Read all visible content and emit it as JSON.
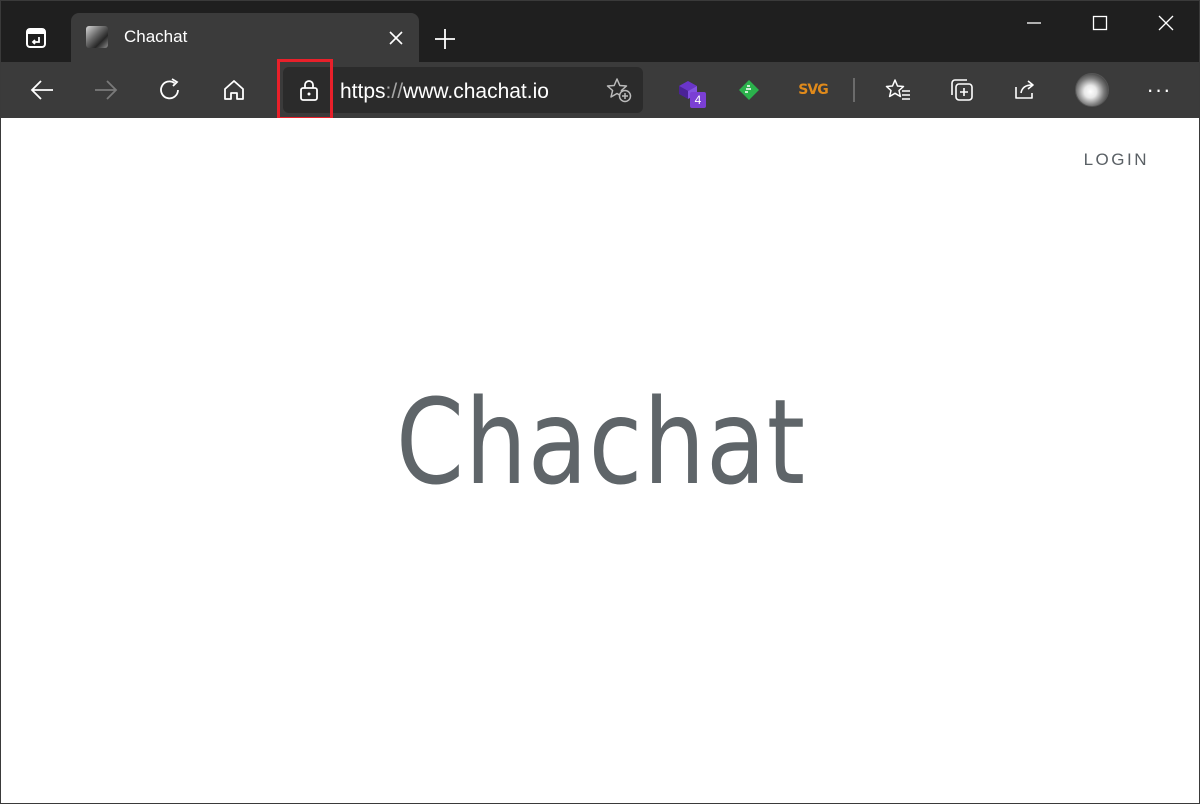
{
  "browser": {
    "tab": {
      "title": "Chachat"
    },
    "address_bar": {
      "scheme": "https",
      "separator": "://",
      "host": "www.chachat.io"
    },
    "extensions": [
      {
        "name": "extension-purple-icon",
        "badge": "4"
      },
      {
        "name": "feedly-icon"
      },
      {
        "name": "svg-extension-icon",
        "label": "SVG"
      }
    ],
    "icons": {
      "back": "back-arrow-icon",
      "forward": "forward-arrow-icon",
      "refresh": "refresh-icon",
      "home": "home-icon",
      "lock": "lock-icon",
      "add_favorite": "add-favorite-icon",
      "favorites": "favorites-icon",
      "collections": "collections-icon",
      "share": "share-icon",
      "more": "more-icon"
    },
    "colors": {
      "titlebar": "#1f1f1f",
      "toolbar": "#3b3b3b",
      "highlight": "#e8202a",
      "extension_badge": "#7b3fd4",
      "feedly_green": "#2bb24c",
      "svg_orange": "#e08a1b"
    }
  },
  "page": {
    "login_label": "LOGIN",
    "hero_title": "Chachat",
    "text_color": "#5f6569"
  }
}
